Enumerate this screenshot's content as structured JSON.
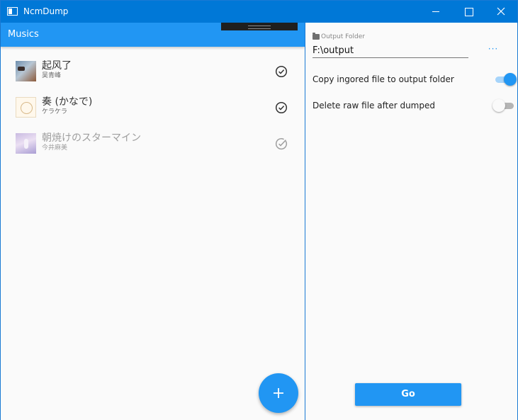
{
  "window": {
    "title": "NcmDump",
    "icon": "app-window-icon",
    "accent": "#0078d7"
  },
  "musics": {
    "header": "Musics",
    "header_color": "#2196f3",
    "items": [
      {
        "title": "起风了",
        "artist": "吴青峰",
        "icon": "check-circle-icon"
      },
      {
        "title": "奏 (かなで)",
        "artist": "ケラケラ",
        "icon": "check-circle-icon"
      },
      {
        "title": "朝焼けのスターマイン",
        "artist": "今井麻美",
        "icon": "check-circle-icon",
        "state": "processing"
      }
    ],
    "add_icon": "plus-icon"
  },
  "settings": {
    "output_folder_label": "Output Folder",
    "output_folder_value": "F:\\output",
    "browse_label": "···",
    "copy_ignored_label": "Copy ingored file to output folder",
    "copy_ignored_enabled": true,
    "delete_raw_label": "Delete raw file after dumped",
    "delete_raw_enabled": false,
    "go_label": "Go"
  }
}
